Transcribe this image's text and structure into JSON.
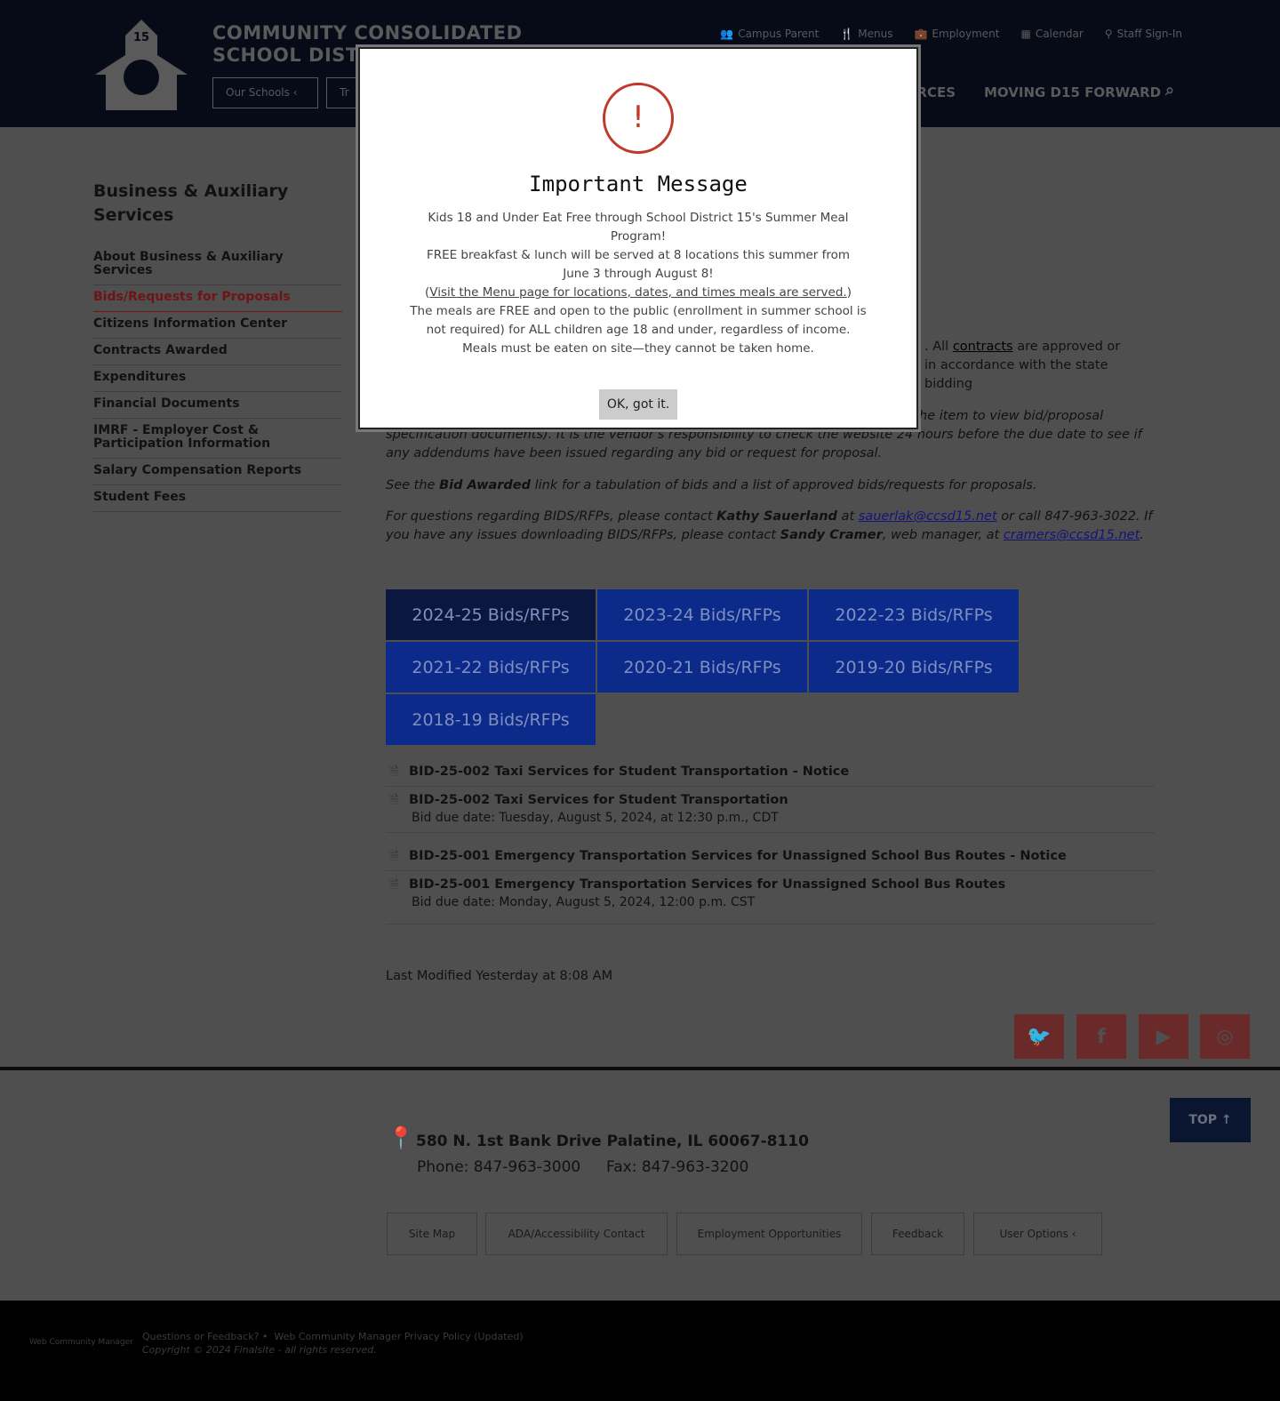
{
  "header": {
    "district_line1": "COMMUNITY CONSOLIDATED",
    "district_line2": "SCHOOL DISTRICT 15",
    "logo_number": "15",
    "utility": [
      {
        "icon": "users-icon",
        "label": "Campus Parent"
      },
      {
        "icon": "utensils-icon",
        "label": "Menus"
      },
      {
        "icon": "briefcase-icon",
        "label": "Employment"
      },
      {
        "icon": "calendar-icon",
        "label": "Calendar"
      },
      {
        "icon": "pin-icon",
        "label": "Staff Sign-In"
      }
    ],
    "our_schools": "Our Schools",
    "translate": "Tr",
    "nav_resources": "RESOURCES",
    "nav_forward": "MOVING D15 FORWARD"
  },
  "sidebar": {
    "title": "Business & Auxiliary Services",
    "items": [
      "About Business & Auxiliary Services",
      "Bids/Requests for Proposals",
      "Citizens Information Center",
      "Contracts Awarded",
      "Expenditures",
      "Financial Documents",
      "IMRF - Employer Cost & Participation Information",
      "Salary Compensation Reports",
      "Student Fees"
    ]
  },
  "content": {
    "p1a": ". All ",
    "p1_link": "contracts",
    "p1b": " are approved or",
    "p1c": "in accordance with the state bidding",
    "p2a": "he item to view bid/proposal",
    "p2b": "specification documents). It is the vendor's responsibility to check the website 24 hours before the due date to see if any addendums have been issued regarding any bid or request for proposal.",
    "p3a": "See the ",
    "p3b": "Bid Awarded",
    "p3c": " link for a tabulation of bids and a list of approved bids/requests for proposals.",
    "p4a": "For questions regarding BIDS/RFPs, please contact ",
    "p4b": "Kathy Sauerland",
    "p4c": " at ",
    "p4d": "sauerlak@ccsd15.net",
    "p4e": " or call 847-963-3022. If you have any issues downloading BIDS/RFPs, please contact ",
    "p4f": "Sandy Cramer",
    "p4g": ", web manager, at ",
    "p4h": "cramers@ccsd15.net",
    "p4i": ".",
    "tiles": [
      "2024-25 Bids/RFPs",
      "2023-24 Bids/RFPs",
      "2022-23 Bids/RFPs",
      "2021-22 Bids/RFPs",
      "2020-21 Bids/RFPs",
      "2019-20 Bids/RFPs",
      "2018-19 Bids/RFPs"
    ],
    "docs": [
      {
        "title": "BID-25-002 Taxi Services for Student Transportation - Notice"
      },
      {
        "title": "BID-25-002 Taxi Services for Student Transportation",
        "due": "Bid due date: Tuesday, August 5, 2024, at 12:30 p.m., CDT"
      },
      {
        "title": "BID-25-001 Emergency Transportation Services for Unassigned School Bus Routes - Notice"
      },
      {
        "title": "BID-25-001 Emergency Transportation Services for Unassigned School Bus Routes",
        "due": "Bid due date: Monday, August 5, 2024, 12:00 p.m. CST"
      }
    ],
    "last_modified": "Last Modified Yesterday at 8:08 AM"
  },
  "footer": {
    "address": "580 N. 1st Bank Drive Palatine, IL 60067-8110",
    "phone": "Phone: 847-963-3000",
    "fax": "Fax: 847-963-3200",
    "top": "TOP",
    "links": [
      "Site Map",
      "ADA/Accessibility Contact",
      "Employment Opportunities",
      "Feedback",
      "User Options"
    ],
    "wcm": "Web Community Manager",
    "questions": "Questions or Feedback? •",
    "privacy": "Web Community Manager Privacy Policy (Updated)",
    "copyright": "Copyright © 2024 Finalsite - all rights reserved."
  },
  "social": [
    "twitter-icon",
    "facebook-icon",
    "youtube-icon",
    "instagram-icon"
  ],
  "modal": {
    "title": "Important Message",
    "l1": "Kids 18 and Under Eat Free through School District 15's Summer Meal Program!",
    "l2": "FREE breakfast & lunch will be served at 8 locations this summer from",
    "l3": "June 3 through August 8!",
    "link": "Visit the Menu page for locations, dates, and times meals are served.",
    "l4": "The meals are FREE and open to the public (enrollment in summer school is not required) for ALL children age 18 and under, regardless of income. Meals must be eaten on site—they cannot be taken home.",
    "ok": "OK, got it."
  },
  "colors": {
    "alert": "#c0392b",
    "tile": "#0b2a8a",
    "active": "#6e1414"
  }
}
